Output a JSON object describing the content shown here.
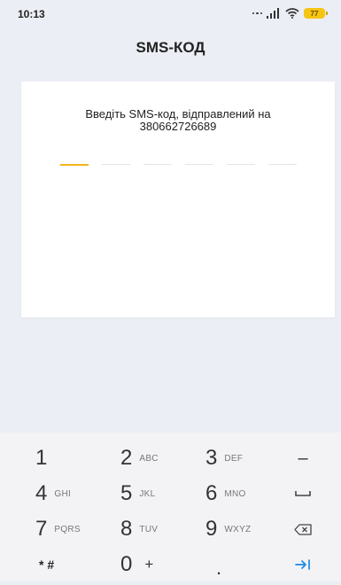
{
  "status_bar": {
    "time": "10:13",
    "battery_level": "77"
  },
  "header": {
    "title": "SMS-КОД"
  },
  "card": {
    "instruction_line1": "Введіть SMS-код, відправлений на",
    "instruction_line2": "380662726689",
    "code_slots_count": 6,
    "active_slot_index": 0,
    "active_color": "#f3b51a"
  },
  "keyboard": {
    "row1": [
      {
        "num": "1",
        "letters": ""
      },
      {
        "num": "2",
        "letters": "ABC"
      },
      {
        "num": "3",
        "letters": "DEF"
      }
    ],
    "row2": [
      {
        "num": "4",
        "letters": "GHI"
      },
      {
        "num": "5",
        "letters": "JKL"
      },
      {
        "num": "6",
        "letters": "MNO"
      }
    ],
    "row3": [
      {
        "num": "7",
        "letters": "PQRS"
      },
      {
        "num": "8",
        "letters": "TUV"
      },
      {
        "num": "9",
        "letters": "WXYZ"
      }
    ],
    "row4": {
      "symbols": "* #",
      "zero": "0",
      "plus": "+",
      "dot": "."
    },
    "minus": "–",
    "space_icon": "space-icon",
    "backspace_icon": "backspace-icon",
    "next_icon": "tab-next-icon",
    "accent_color": "#1e88e5"
  }
}
